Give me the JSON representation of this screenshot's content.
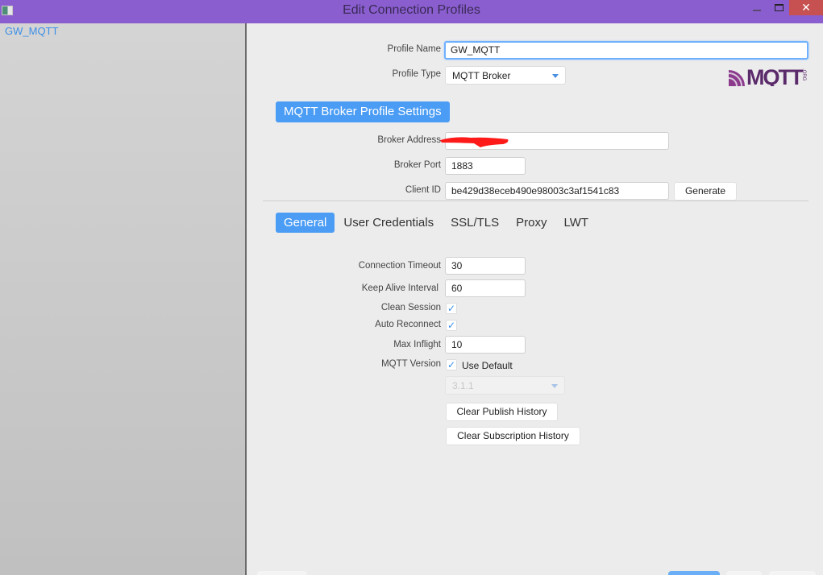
{
  "window": {
    "title": "Edit Connection Profiles",
    "close_glyph": "✕"
  },
  "sidebar": {
    "items": [
      {
        "label": "GW_MQTT",
        "selected": true
      }
    ]
  },
  "profile": {
    "name_label": "Profile Name",
    "name_value": "GW_MQTT",
    "type_label": "Profile Type",
    "type_value": "MQTT Broker",
    "logo_text": "MQTT",
    "logo_suffix": ".ORG"
  },
  "broker_settings": {
    "header": "MQTT Broker Profile Settings",
    "address_label": "Broker Address",
    "address_value": "",
    "port_label": "Broker Port",
    "port_value": "1883",
    "client_id_label": "Client ID",
    "client_id_value": "be429d38eceb490e98003c3af1541c83",
    "generate_label": "Generate"
  },
  "tabs": [
    {
      "label": "General",
      "active": true
    },
    {
      "label": "User Credentials",
      "active": false
    },
    {
      "label": "SSL/TLS",
      "active": false
    },
    {
      "label": "Proxy",
      "active": false
    },
    {
      "label": "LWT",
      "active": false
    }
  ],
  "general": {
    "connection_timeout_label": "Connection Timeout",
    "connection_timeout_value": "30",
    "keep_alive_label": "Keep Alive Interval",
    "keep_alive_value": "60",
    "clean_session_label": "Clean Session",
    "clean_session_checked": true,
    "auto_reconnect_label": "Auto Reconnect",
    "auto_reconnect_checked": true,
    "max_inflight_label": "Max Inflight",
    "max_inflight_value": "10",
    "mqtt_version_label": "MQTT Version",
    "use_default_label": "Use Default",
    "use_default_checked": true,
    "version_value": "3.1.1",
    "clear_publish_label": "Clear Publish History",
    "clear_subscription_label": "Clear Subscription History"
  },
  "glyphs": {
    "check": "✓"
  },
  "colors": {
    "titlebar": "#8a5ecf",
    "accent": "#4a9cf5",
    "close": "#c75050",
    "redaction": "#ff1a1a"
  }
}
